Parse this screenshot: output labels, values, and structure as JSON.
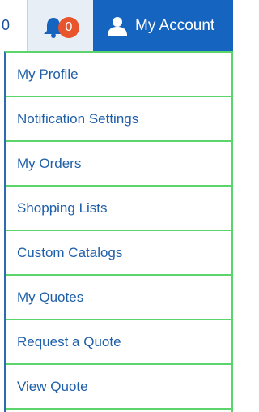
{
  "topbar": {
    "prev_fragment": "0",
    "notifications_count": "0",
    "account_label": "My Account",
    "colors": {
      "account_bg": "#1565c0",
      "bell": "#1565c0",
      "badge": "#e8552c"
    }
  },
  "menu": {
    "items": [
      {
        "label": "My Profile"
      },
      {
        "label": "Notification Settings"
      },
      {
        "label": "My Orders"
      },
      {
        "label": "Shopping Lists"
      },
      {
        "label": "Custom Catalogs"
      },
      {
        "label": "My Quotes"
      },
      {
        "label": "Request a Quote"
      },
      {
        "label": "View Quote"
      }
    ]
  }
}
